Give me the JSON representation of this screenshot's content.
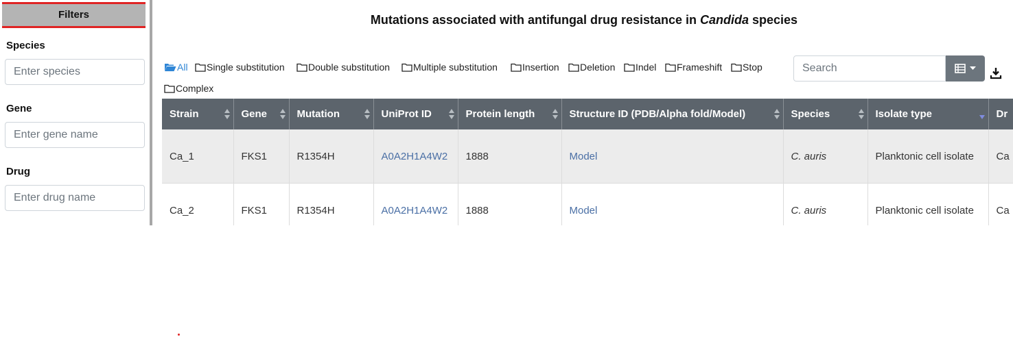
{
  "sidebar": {
    "header": "Filters",
    "filters": [
      {
        "label": "Species",
        "placeholder": "Enter species"
      },
      {
        "label": "Gene",
        "placeholder": "Enter gene name"
      },
      {
        "label": "Drug",
        "placeholder": "Enter drug name"
      }
    ]
  },
  "title": {
    "prefix": "Mutations associated with antifungal drug resistance in ",
    "italic": "Candida",
    "suffix": " species"
  },
  "type_filters": [
    {
      "label": "All",
      "active": true
    },
    {
      "label": "Single substitution"
    },
    {
      "label": "Double substitution"
    },
    {
      "label": "Multiple substitution"
    },
    {
      "label": "Insertion"
    },
    {
      "label": "Deletion"
    },
    {
      "label": "Indel"
    },
    {
      "label": "Frameshift"
    },
    {
      "label": "Stop"
    },
    {
      "label": "Complex"
    }
  ],
  "search": {
    "placeholder": "Search"
  },
  "table": {
    "headers": [
      "Strain",
      "Gene",
      "Mutation",
      "UniProt ID",
      "Protein length",
      "Structure ID (PDB/Alpha fold/Model)",
      "Species",
      "Isolate type",
      "Dr"
    ],
    "rows": [
      [
        "Ca_1",
        "FKS1",
        "R1354H",
        "A0A2H1A4W2",
        "1888",
        "Model",
        "C. auris",
        "Planktonic cell isolate",
        "Ca"
      ],
      [
        "Ca_2",
        "FKS1",
        "R1354H",
        "A0A2H1A4W2",
        "1888",
        "Model",
        "C. auris",
        "Planktonic cell isolate",
        "Ca"
      ]
    ]
  },
  "colors": {
    "header_bg": "#5c646c",
    "link": "#4a6fa5",
    "accent_red": "#e02424",
    "active_filter": "#2f86d6"
  }
}
